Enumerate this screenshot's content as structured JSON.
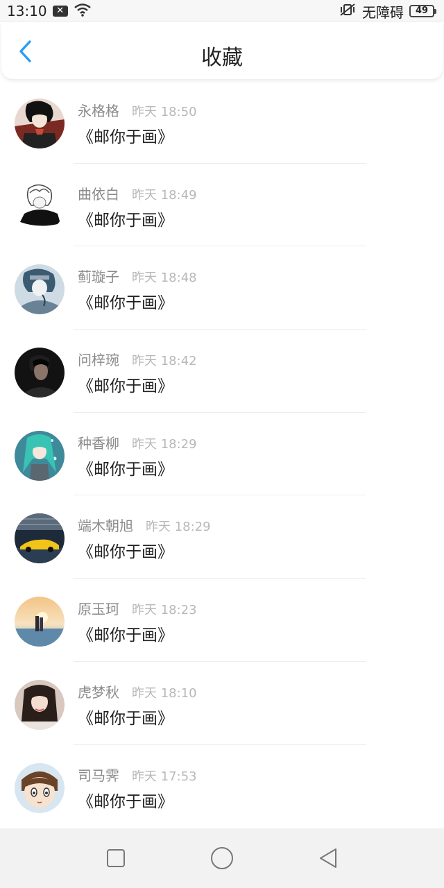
{
  "status_bar": {
    "time": "13:10",
    "network_label": "无障碍",
    "battery": "49"
  },
  "header": {
    "title": "收藏",
    "back_icon": "chevron-left-icon",
    "accent_color": "#2a9df4"
  },
  "items": [
    {
      "name": "永格格",
      "time": "昨天 18:50",
      "title": "《邮你于画》"
    },
    {
      "name": "曲依白",
      "time": "昨天 18:49",
      "title": "《邮你于画》"
    },
    {
      "name": "蓟璇子",
      "time": "昨天 18:48",
      "title": "《邮你于画》"
    },
    {
      "name": "问梓琬",
      "time": "昨天 18:42",
      "title": "《邮你于画》"
    },
    {
      "name": "种香柳",
      "time": "昨天 18:29",
      "title": "《邮你于画》"
    },
    {
      "name": "端木朝旭",
      "time": "昨天 18:29",
      "title": "《邮你于画》"
    },
    {
      "name": "原玉珂",
      "time": "昨天 18:23",
      "title": "《邮你于画》"
    },
    {
      "name": "虎梦秋",
      "time": "昨天 18:10",
      "title": "《邮你于画》"
    },
    {
      "name": "司马霁",
      "time": "昨天 17:53",
      "title": "《邮你于画》"
    }
  ],
  "nav_bar": {
    "recent_icon": "square-icon",
    "home_icon": "circle-icon",
    "back_icon": "triangle-back-icon"
  }
}
